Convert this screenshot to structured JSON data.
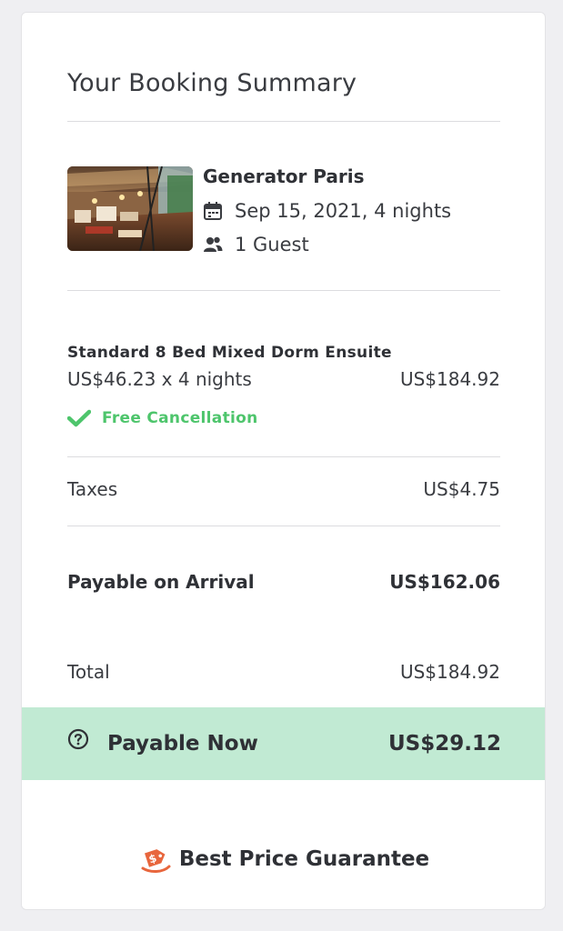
{
  "summary": {
    "title": "Your Booking Summary"
  },
  "hotel": {
    "name": "Generator Paris",
    "dates": "Sep 15, 2021, 4 nights",
    "guests": "1 Guest",
    "calendar_icon": "calendar-icon",
    "guests_icon": "people-icon"
  },
  "room": {
    "name": "Standard 8 Bed Mixed Dorm Ensuite",
    "rate_line": "US$46.23 x 4 nights",
    "rate_total": "US$184.92",
    "cancellation": "Free Cancellation",
    "cancellation_icon": "checkmark-icon"
  },
  "taxes": {
    "label": "Taxes",
    "value": "US$4.75"
  },
  "payable_on_arrival": {
    "label": "Payable on Arrival",
    "value": "US$162.06"
  },
  "total": {
    "label": "Total",
    "value": "US$184.92"
  },
  "payable_now": {
    "label": "Payable Now",
    "value": "US$29.12",
    "icon": "question-circle-icon"
  },
  "guarantee": {
    "label": "Best Price Guarantee",
    "icon": "price-tag-icon"
  },
  "colors": {
    "accent_green": "#4ec56c",
    "payable_now_bg": "#c1ead3",
    "guarantee_icon": "#e8663d"
  }
}
